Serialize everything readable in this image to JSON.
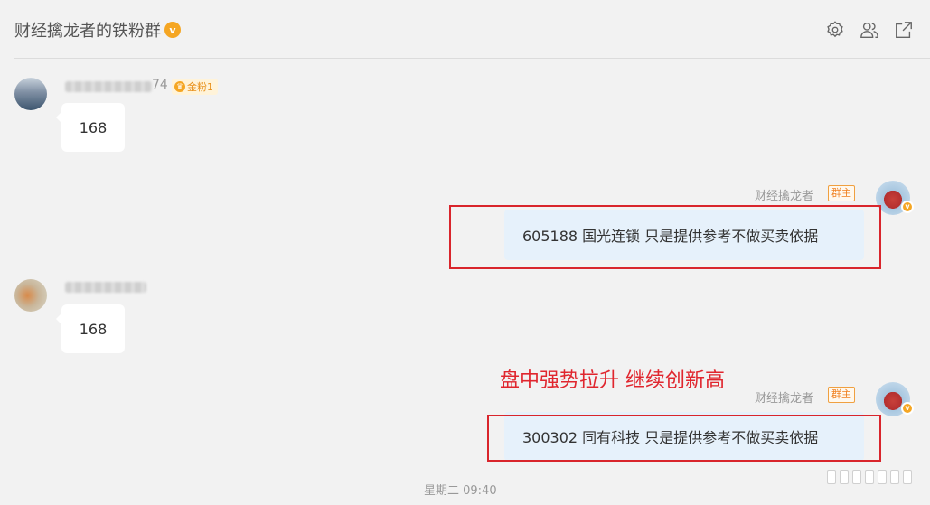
{
  "header": {
    "title": "财经擒龙者的铁粉群",
    "title_badge": "v"
  },
  "messages": [
    {
      "side": "left",
      "username_suffix": "74",
      "fan_badge": "金粉1",
      "text": "168"
    },
    {
      "side": "right",
      "sender": "财经擒龙者",
      "role_tag": "群主",
      "text": "605188 国光连锁   只是提供参考不做买卖依据"
    },
    {
      "side": "left",
      "text": "168"
    },
    {
      "side": "right",
      "sender": "财经擒龙者",
      "role_tag": "群主",
      "text": "300302 同有科技   只是提供参考不做买卖依据"
    }
  ],
  "annotation": "盘中强势拉升 继续创新高",
  "timestamp": "星期二 09:40",
  "colors": {
    "background": "#f2f2f2",
    "accent_red": "#d9252c",
    "my_bubble": "#e6f1fb",
    "vip_orange": "#f5a623"
  }
}
